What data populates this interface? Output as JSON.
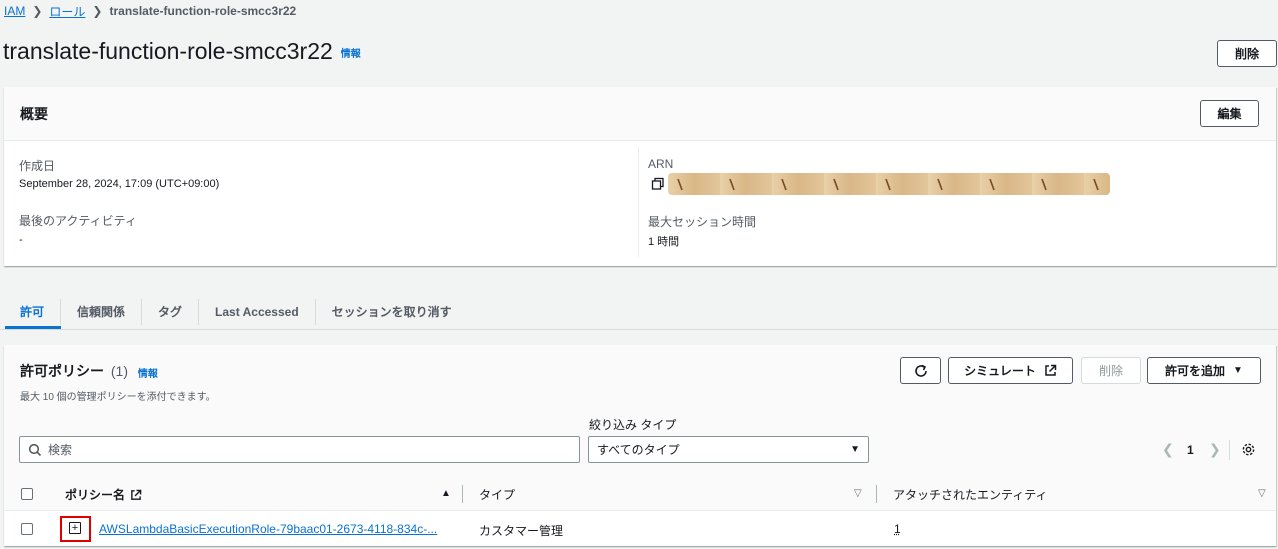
{
  "breadcrumb": {
    "items": [
      "IAM",
      "ロール"
    ],
    "current": "translate-function-role-smcc3r22"
  },
  "header": {
    "title": "translate-function-role-smcc3r22",
    "info": "情報",
    "delete_label": "削除"
  },
  "summary": {
    "title": "概要",
    "edit_label": "編集",
    "created_label": "作成日",
    "created_value": "September 28, 2024, 17:09 (UTC+09:00)",
    "last_activity_label": "最後のアクティビティ",
    "last_activity_value": "-",
    "arn_label": "ARN",
    "max_session_label": "最大セッション時間",
    "max_session_value": "1 時間"
  },
  "tabs": [
    {
      "label": "許可",
      "active": true
    },
    {
      "label": "信頼関係",
      "active": false
    },
    {
      "label": "タグ",
      "active": false
    },
    {
      "label": "Last Accessed",
      "active": false
    },
    {
      "label": "セッションを取り消す",
      "active": false
    }
  ],
  "policies": {
    "title": "許可ポリシー",
    "count": "(1)",
    "info": "情報",
    "description": "最大 10 個の管理ポリシーを添付できます。",
    "simulate_label": "シミュレート",
    "delete_label": "削除",
    "add_label": "許可を追加",
    "filter_type_label": "絞り込み タイプ",
    "search_placeholder": "検索",
    "type_select_value": "すべてのタイプ",
    "page_number": "1",
    "columns": {
      "name": "ポリシー名",
      "type": "タイプ",
      "attached": "アタッチされたエンティティ"
    },
    "rows": [
      {
        "name": "AWSLambdaBasicExecutionRole-79baac01-2673-4118-834c-...",
        "type": "カスタマー管理",
        "attached": "1"
      }
    ]
  },
  "colors": {
    "link": "#0972d3",
    "highlight_box": "#e00000"
  }
}
